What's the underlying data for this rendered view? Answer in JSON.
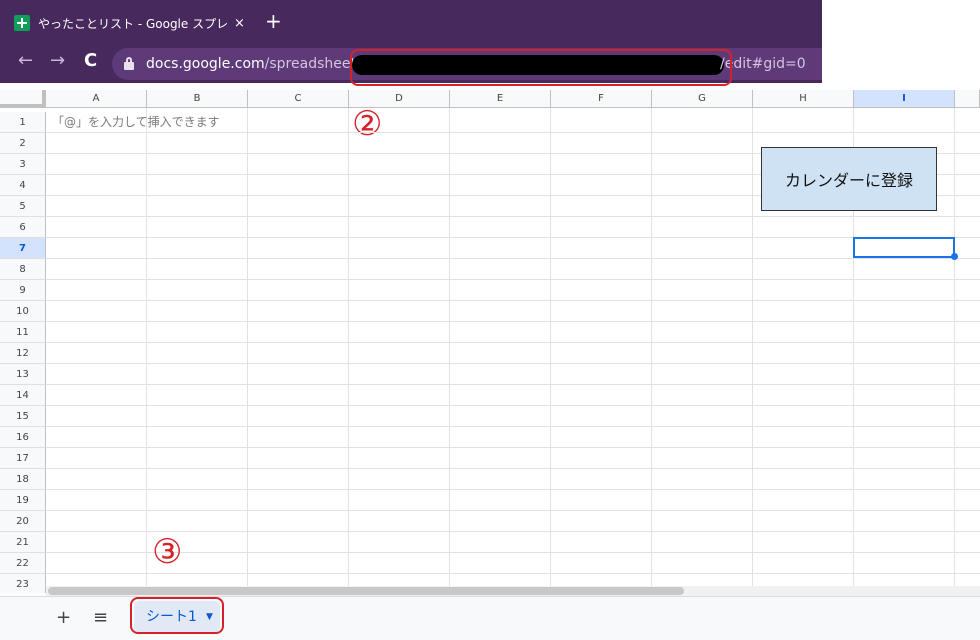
{
  "browser": {
    "tab_title": "やったことリスト - Google スプレッドシ",
    "tab_close": "×",
    "new_tab": "+",
    "back": "←",
    "forward": "→",
    "reload": "C",
    "url_host": "docs.google.com",
    "url_path": "/spreadsheets/d/",
    "url_tail": "/edit#gid=0"
  },
  "sheet": {
    "columns": [
      "A",
      "B",
      "C",
      "D",
      "E",
      "F",
      "G",
      "H",
      "I"
    ],
    "selected_column": "I",
    "rows": [
      "1",
      "2",
      "3",
      "4",
      "5",
      "6",
      "7",
      "8",
      "9",
      "10",
      "11",
      "12",
      "13",
      "14",
      "15",
      "16",
      "17",
      "18",
      "19",
      "20",
      "21",
      "22",
      "23"
    ],
    "selected_row": "7",
    "a1_placeholder": "「@」を入力して挿入できます",
    "calendar_button": "カレンダーに登録"
  },
  "bottom": {
    "add_sheet": "+",
    "all_sheets": "≡",
    "sheet_tab": "シート1",
    "sheet_arrow": "▼"
  },
  "annotations": {
    "num2": "②",
    "num3": "③",
    "color": "#d6212b"
  },
  "colors": {
    "browser_bg": "#47295d",
    "selection": "#1a73e8",
    "button_fill": "#cfe2f3"
  }
}
